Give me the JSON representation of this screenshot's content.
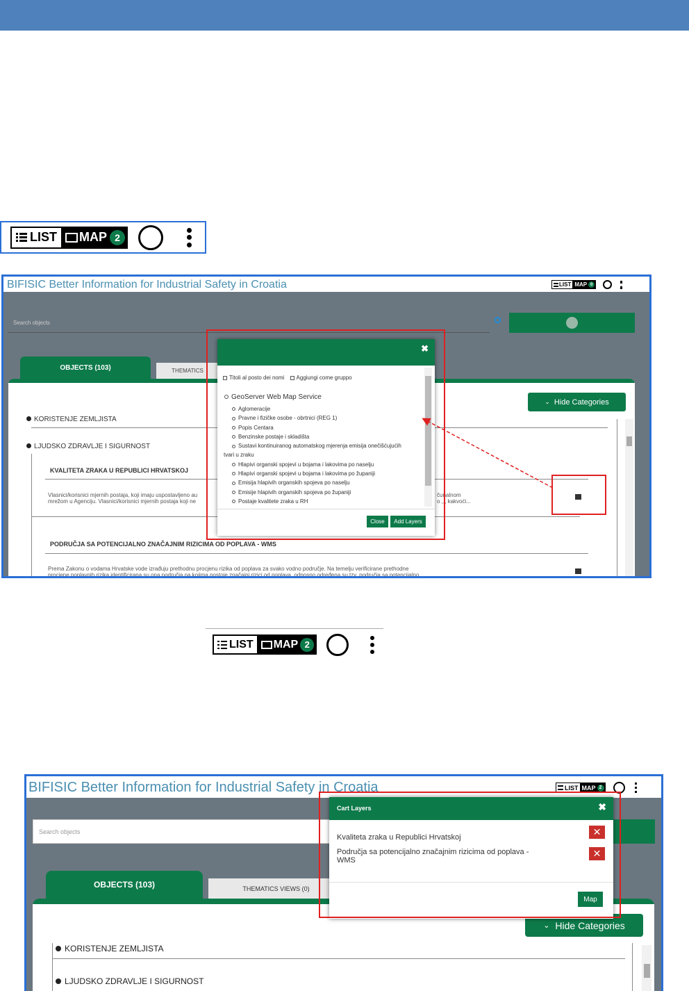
{
  "toolbar": {
    "list_label": "LIST",
    "map_label": "MAP",
    "map_count": "2"
  },
  "toolbar_small": {
    "list_label": "LIST",
    "map_label": "MAP",
    "map_count": "0"
  },
  "app": {
    "title": "BIFISIC Better Information for Industrial Safety in Croatia",
    "search_placeholder": "Search objects",
    "tab_objects": "OBJECTS (103)",
    "tab_thematics_short": "THEMATICS",
    "tab_thematics": "THEMATICS VIEWS (0)",
    "hide_categories": "Hide Categories"
  },
  "shot1": {
    "categories": {
      "c1": "KORISTENJE ZEMLJISTA",
      "c2": "LJUDSKO ZDRAVLJE I SIGURNOST"
    },
    "item1_title": "KVALITETA ZRAKA U REPUBLICI HRVATSKOJ",
    "item1_desc_l1": "Vlasnici/korisnici mjernih postaja, koji imaju uspostavljeno au",
    "item1_desc_l2": "mrežom u Agenciju. Vlasnici/korisnici mjernih postaja koji ne",
    "item1_desc_r1": "čunalnom",
    "item1_desc_r2": "o ,,, kakvoći...",
    "item2_title": "PODRUČJA SA POTENCIJALNO ZNAČAJNIM RIZICIMA OD POPLAVA - WMS",
    "item2_desc_l1": "Prema Zakonu o vodama Hrvatske vode izrađuju prethodnu procjenu rizika od poplava za svako vodno područje. Na temelju verificirane prethodne",
    "item2_desc_l2": "procjene poplavnih rizika identificirana su ona područja na kojima postoje značajni rizici od poplava, odnosno određena su tzv. područja sa potencijalno",
    "modal": {
      "opt1": "Titoli al posto dei nomi",
      "opt2": "Aggiungi come gruppo",
      "service": "GeoServer Web Map Service",
      "layers": [
        "Aglomeracije",
        "Pravne i fizičke osobe - obrtnici (REG 1)",
        "Popis Centara",
        "Benzinske postaje i skladišta",
        "Sustavi kontinuiranog automatskog mjerenja emisija onečišćujućih",
        "Hlapivi organski spojevi u bojama i lakovima po naselju",
        "Hlapivi organski spojevi u bojama i lakovima po županiji",
        "Emisija hlapivih organskih spojeva po naselju",
        "Emisije hlapivih organskih spojeva po županiji",
        "Postaje kvalitete zraka u RH"
      ],
      "layer_wrap": "tvari u zraku",
      "close": "Close",
      "add_layers": "Add Layers"
    }
  },
  "shot2": {
    "cart_title": "Cart Layers",
    "cart_items": [
      "Kvaliteta zraka u Republici Hrvatskoj",
      "Područja sa potencijalno značajnim rizicima od poplava -",
      "WMS"
    ],
    "map_button": "Map",
    "categories": {
      "c1": "KORISTENJE ZEMLJISTA",
      "c2": "LJUDSKO ZDRAVLJE I SIGURNOST"
    }
  },
  "colors": {
    "accent": "#0d7a4a",
    "header": "#4f81bd",
    "highlight": "#e02020",
    "frame": "#2a6fd6"
  }
}
